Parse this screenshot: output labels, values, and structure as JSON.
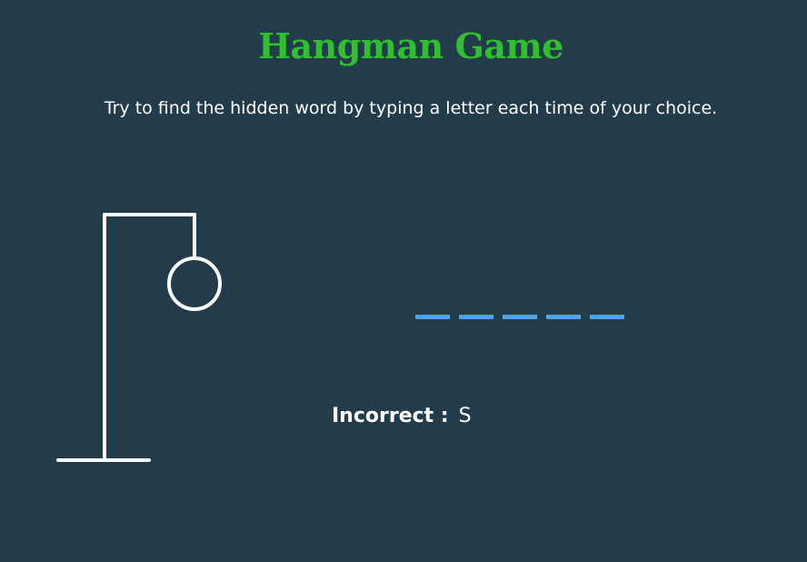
{
  "game": {
    "title": "Hangman Game",
    "instructions": "Try to find the hidden word by typing a letter each time of your choice.",
    "word_blanks": [
      "_",
      "_",
      "_",
      "_",
      "_"
    ],
    "incorrect_label": "Incorrect :",
    "incorrect_letters": "S",
    "figure_parts_shown": [
      "base",
      "pole",
      "beam",
      "rope",
      "head"
    ]
  },
  "colors": {
    "background": "#233c4b",
    "title": "#2fbf2f",
    "text": "#ffffff",
    "blank": "#4da3e6",
    "figure": "#ffffff"
  }
}
